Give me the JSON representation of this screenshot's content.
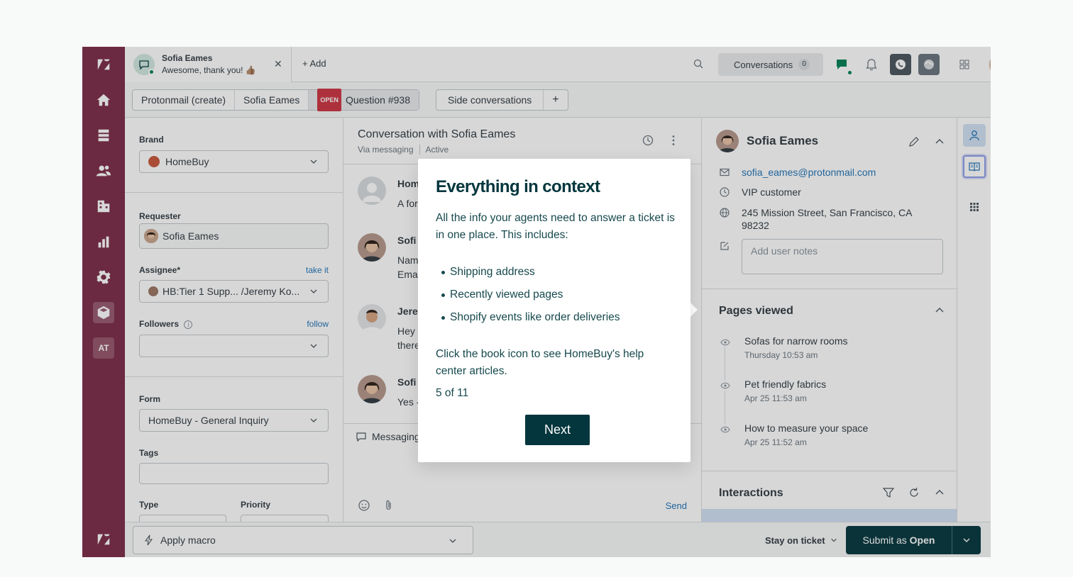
{
  "header": {
    "conversation": {
      "name": "Sofia Eames",
      "message": "Awesome, thank you! 👍🏽"
    },
    "add_label": "Add",
    "conversations_label": "Conversations",
    "conversations_count": "0"
  },
  "ticket_tabs": {
    "crumbs": [
      "Protonmail (create)",
      "Sofia Eames",
      "Question #938"
    ],
    "status_badge": "OPEN",
    "side_conversations": "Side conversations",
    "plus": "+"
  },
  "nav": {
    "at_label": "AT"
  },
  "properties": {
    "brand_label": "Brand",
    "brand_value": "HomeBuy",
    "requester_label": "Requester",
    "requester_value": "Sofia Eames",
    "assignee_label": "Assignee*",
    "assignee_link": "take it",
    "assignee_value": "HB:Tier 1 Supp... /Jeremy Ko...",
    "followers_label": "Followers",
    "followers_link": "follow",
    "form_label": "Form",
    "form_value": "HomeBuy - General Inquiry",
    "tags_label": "Tags",
    "type_label": "Type",
    "priority_label": "Priority"
  },
  "conversation": {
    "title": "Conversation with Sofia Eames",
    "channel": "Via messaging",
    "status": "Active",
    "messages": [
      {
        "name": "Hom",
        "lines": [
          "A for"
        ]
      },
      {
        "name": "Sofi",
        "lines": [
          "Nam",
          "Ema"
        ]
      },
      {
        "name": "Jere",
        "lines": [
          "Hey",
          "there"
        ]
      },
      {
        "name": "Sofi",
        "lines": [
          "Yes -"
        ]
      }
    ],
    "compose_channel": "Messaging",
    "send_label": "Send"
  },
  "context": {
    "name": "Sofia Eames",
    "email": "sofia_eames@protonmail.com",
    "tier": "VIP customer",
    "address": "245 Mission Street, San Francisco, CA 98232",
    "notes_placeholder": "Add user notes",
    "pages_viewed_title": "Pages viewed",
    "pages": [
      {
        "title": "Sofas for narrow rooms",
        "date": "Thursday 10:53 am"
      },
      {
        "title": "Pet friendly fabrics",
        "date": "Apr 25 11:53 am"
      },
      {
        "title": "How to measure your space",
        "date": "Apr 25 11:52 am"
      }
    ],
    "interactions_title": "Interactions"
  },
  "footer": {
    "macro_label": "Apply macro",
    "stay_label": "Stay on ticket",
    "submit_prefix": "Submit as",
    "submit_status": "Open"
  },
  "popover": {
    "title": "Everything in context",
    "intro": "All the info your agents need to answer a ticket is in one place. This includes:",
    "bullets": [
      "Shipping address",
      "Recently viewed pages",
      "Shopify events like order deliveries"
    ],
    "outro": "Click the book icon to see HomeBuy's help center articles.",
    "step": "5 of 11",
    "next_label": "Next"
  }
}
